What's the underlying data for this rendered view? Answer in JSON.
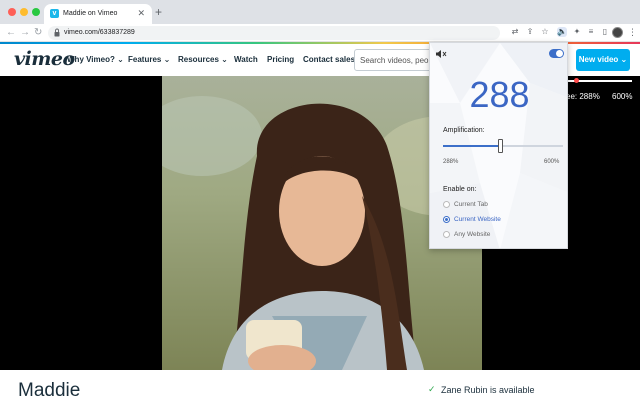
{
  "browser": {
    "tab_title": "Maddie on Vimeo",
    "url": "vimeo.com/633837289",
    "icons": [
      "back-arrow",
      "forward-arrow",
      "reload",
      "lock",
      "translate",
      "share",
      "bookmark-star",
      "volume-booster-extension",
      "puzzle",
      "playlist",
      "sidebar",
      "profile-avatar",
      "more-menu"
    ]
  },
  "vimeo": {
    "logo": "vimeo",
    "nav": [
      "Why Vimeo?",
      "Features",
      "Resources",
      "Watch",
      "Pricing",
      "Contact sales"
    ],
    "search_placeholder": "Search videos, people...",
    "new_video": "New video",
    "speed_left": "ee: 288%",
    "speed_right": "600%",
    "video_title": "Maddie",
    "availability": "Zane Rubin is available"
  },
  "extension": {
    "volume_value": "288",
    "amplification_label": "Amplification:",
    "amplification_percent": 288,
    "range_min": "288%",
    "range_max": "600%",
    "slider_fraction": 0.48,
    "enable_label": "Enable on:",
    "enable_options": [
      {
        "label": "Current Tab",
        "selected": false
      },
      {
        "label": "Current Website",
        "selected": true
      },
      {
        "label": "Any Website",
        "selected": false
      }
    ],
    "enabled": true
  },
  "colors": {
    "accent_blue": "#3b66c4",
    "vimeo_blue": "#00adef",
    "vimeo_dark": "#1a2e3b"
  }
}
